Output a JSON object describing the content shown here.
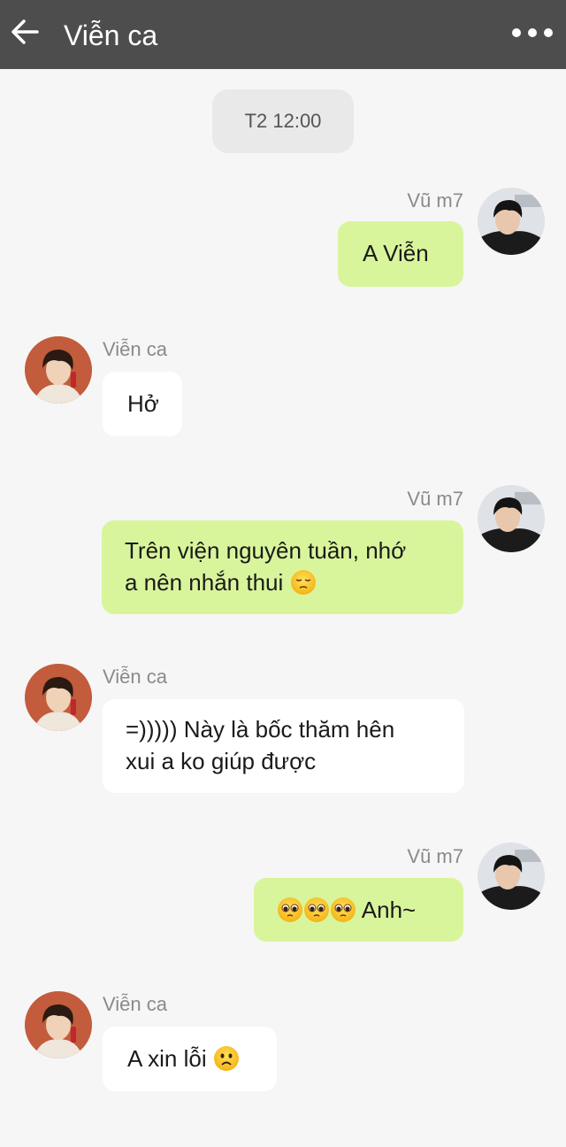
{
  "header": {
    "title": "Viễn ca",
    "back_icon": "arrow-left-icon",
    "more_icon": "more-dots-icon"
  },
  "chat": {
    "timestamp": "T2 12:00",
    "messages": [
      {
        "from": "me",
        "sender": "Vũ m7",
        "text": "A Viễn"
      },
      {
        "from": "them",
        "sender": "Viễn ca",
        "text": "Hở"
      },
      {
        "from": "me",
        "sender": "Vũ m7",
        "line1": "Trên viện nguyên tuần, nhớ",
        "line2": "a nên nhắn thui",
        "emoji": "pensive-face"
      },
      {
        "from": "them",
        "sender": "Viễn ca",
        "line1": "=))))) Này là bốc thăm hên",
        "line2": "xui a ko giúp được"
      },
      {
        "from": "me",
        "sender": "Vũ m7",
        "text": "Anh~",
        "emoji": "pleading-face x3"
      },
      {
        "from": "them",
        "sender": "Viễn ca",
        "text": "A xin lỗi",
        "emoji": "worried-face"
      }
    ]
  },
  "colors": {
    "header_bg": "#4d4d4d",
    "outgoing_bubble": "#d9f59c",
    "incoming_bubble": "#ffffff",
    "chat_bg": "#f6f6f6"
  }
}
